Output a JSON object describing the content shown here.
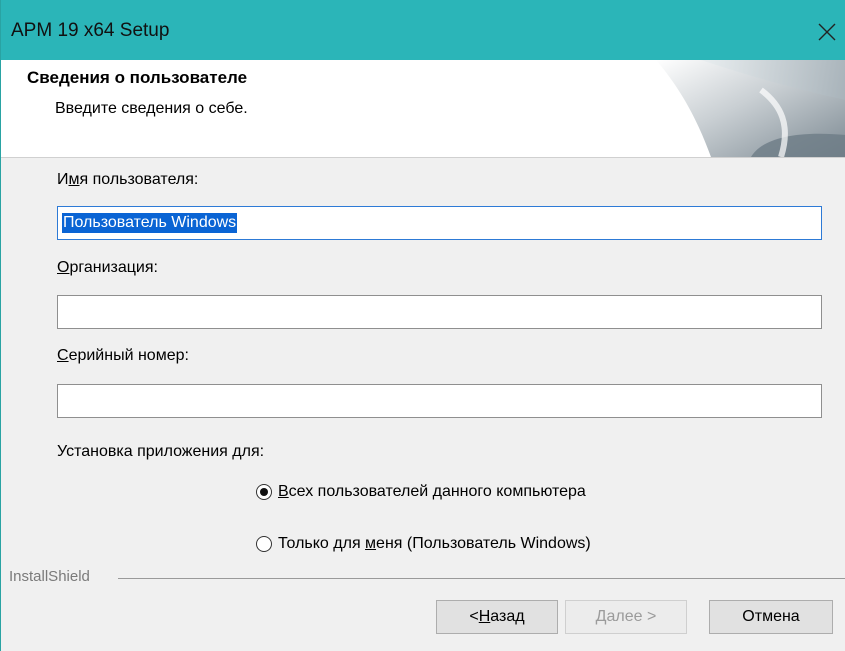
{
  "window": {
    "title": "APM 19 x64  Setup",
    "close_glyph": "✕"
  },
  "header": {
    "title": "Сведения о пользователе",
    "subtitle": "Введите сведения о себе."
  },
  "form": {
    "username": {
      "label_prefix": "И",
      "label_underline": "м",
      "label_rest": "я пользователя:",
      "value": "Пользователь Windows"
    },
    "organization": {
      "label_underline": "О",
      "label_rest": "рганизация:",
      "value": ""
    },
    "serial": {
      "label_underline": "С",
      "label_rest": "ерийный номер:",
      "value": ""
    },
    "install_for": {
      "label": "Установка приложения для:",
      "options": [
        {
          "label_underline": "В",
          "label_rest": "сех пользователей данного компьютера",
          "selected": true
        },
        {
          "label_prefix": "Только для ",
          "label_underline": "м",
          "label_rest": "еня (Пользователь Windows)",
          "selected": false
        }
      ]
    }
  },
  "footer": {
    "brand": "InstallShield",
    "back": {
      "prefix": "< ",
      "underline": "Н",
      "rest": "азад"
    },
    "next": {
      "underline": "Д",
      "rest": "алее >"
    },
    "cancel": "Отмена"
  },
  "colors": {
    "titlebar": "#2bb5b8",
    "selection": "#0a64d4",
    "focus_border": "#2d7ad6"
  }
}
